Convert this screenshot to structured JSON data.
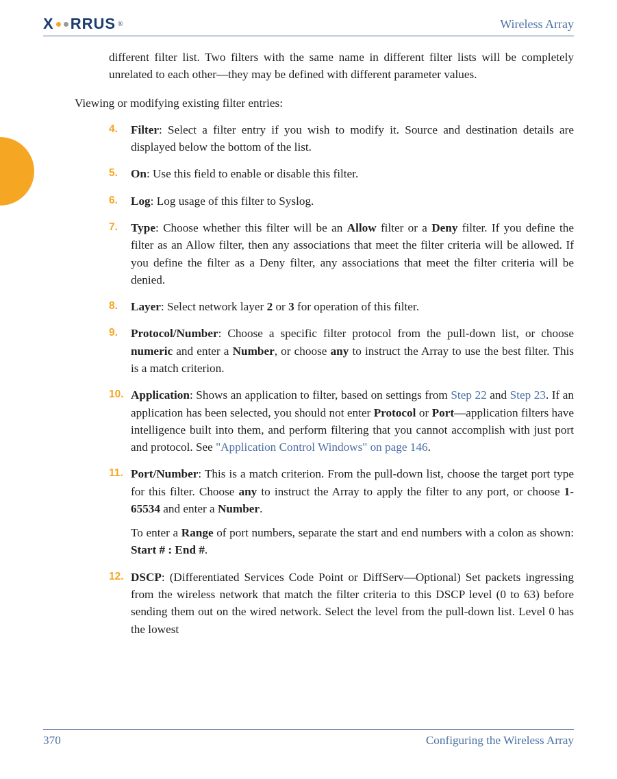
{
  "header": {
    "logo_text_1": "X",
    "logo_text_2": "RRUS",
    "logo_reg": "®",
    "right": "Wireless Array"
  },
  "intro": "different filter list. Two filters with the same name in different filter lists will be completely unrelated to each other—they may be defined with different parameter values.",
  "section_head": "Viewing or modifying existing filter entries:",
  "items": {
    "n4": "4.",
    "t4_b": "Filter",
    "t4": ": Select a filter entry if you wish to modify it. Source and destination details are displayed below the bottom of the list.",
    "n5": "5.",
    "t5_b": "On",
    "t5": ": Use this field to enable or disable this filter.",
    "n6": "6.",
    "t6_b": "Log",
    "t6": ": Log usage of this filter to Syslog.",
    "n7": "7.",
    "t7_b": "Type",
    "t7_a": ": Choose whether this filter will be an ",
    "t7_allow": "Allow",
    "t7_mid": " filter or a ",
    "t7_deny": "Deny",
    "t7_end": " filter. If you define the filter as an Allow filter, then any associations that meet the filter criteria will be allowed. If you define the filter as a Deny filter, any associations that meet the filter criteria will be denied.",
    "n8": "8.",
    "t8_b": "Layer",
    "t8_a": ": Select network layer ",
    "t8_2": "2",
    "t8_or": " or ",
    "t8_3": "3",
    "t8_end": " for operation of this filter.",
    "n9": "9.",
    "t9_b": "Protocol/Number",
    "t9_a": ": Choose a specific filter protocol from the pull-down list, or choose ",
    "t9_num": "numeric",
    "t9_mid": " and enter a ",
    "t9_number": "Number",
    "t9_mid2": ", or choose ",
    "t9_any": "any",
    "t9_end": " to instruct the Array to use the best filter. This is a match criterion.",
    "n10": "10.",
    "t10_b": "Application",
    "t10_a": ": Shows an application to filter, based on settings from ",
    "t10_l1": "Step 22",
    "t10_and": " and ",
    "t10_l2": "Step 23",
    "t10_mid": ". If an application has been selected, you should not enter ",
    "t10_proto": "Protocol",
    "t10_or": " or ",
    "t10_port": "Port",
    "t10_mid2": "—application filters have intelligence built into them, and perform filtering that you cannot accomplish with just port and protocol. See ",
    "t10_l3": "\"Application Control Windows\" on page 146",
    "t10_end": ".",
    "n11": "11.",
    "t11_b": "Port/Number",
    "t11_a": ": This is a match criterion. From the pull-down list, choose the target port type for this filter. Choose ",
    "t11_any": "any",
    "t11_mid": " to instruct the Array to apply the filter to any port, or choose ",
    "t11_range": "1-65534",
    "t11_mid2": " and enter a ",
    "t11_number": "Number",
    "t11_end": ".",
    "t11p2_a": "To enter a ",
    "t11p2_range": "Range",
    "t11p2_mid": " of port numbers, separate the start and end numbers with a colon as shown: ",
    "t11p2_fmt": "Start # : End #",
    "t11p2_end": ".",
    "n12": "12.",
    "t12_b": "DSCP",
    "t12": ": (Differentiated Services Code Point or DiffServ—Optional) Set packets ingressing from the wireless network that match the filter criteria to this DSCP level (0 to 63) before sending them out on the wired network. Select the level from the pull-down list. Level 0 has the lowest"
  },
  "footer": {
    "page": "370",
    "section": "Configuring the Wireless Array"
  }
}
